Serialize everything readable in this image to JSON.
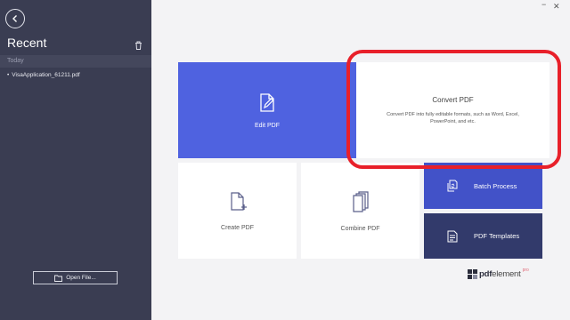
{
  "sidebar": {
    "title": "Recent",
    "section_label": "Today",
    "files": [
      {
        "name": "VisaApplication_61211.pdf"
      }
    ],
    "open_file_label": "Open File..."
  },
  "tiles": {
    "edit_pdf": {
      "label": "Edit PDF"
    },
    "convert_pdf": {
      "title": "Convert PDF",
      "description": "Convert PDF into fully editable formats, such as Word, Excel, PowerPoint, and etc."
    },
    "create_pdf": {
      "label": "Create PDF"
    },
    "combine_pdf": {
      "label": "Combine PDF"
    },
    "batch_process": {
      "label": "Batch Process"
    },
    "pdf_templates": {
      "label": "PDF Templates"
    }
  },
  "brand": {
    "name_bold": "pdf",
    "name_light": "element",
    "badge": "pro"
  },
  "window": {
    "minimize": "−",
    "close": "✕"
  },
  "colors": {
    "sidebar_bg": "#3a3d52",
    "edit_tile": "#4f62e0",
    "batch_tile": "#4252c8",
    "templates_tile": "#323a6b",
    "highlight": "#e8202a"
  }
}
